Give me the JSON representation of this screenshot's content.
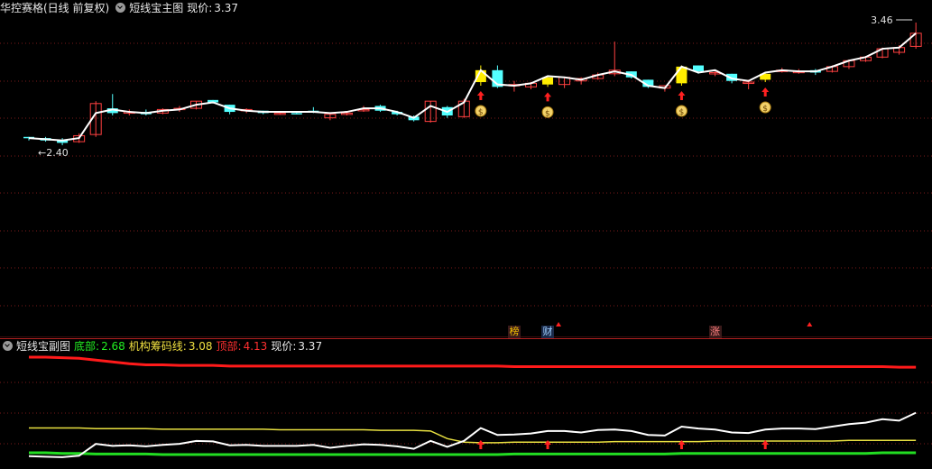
{
  "main_panel": {
    "title": "华控赛格(日线 前复权)",
    "indicator": "短线宝主图",
    "price_label": "现价:",
    "price_value": "3.37",
    "high_label": "3.46",
    "low_label": "2.40"
  },
  "sub_panel": {
    "indicator": "短线宝副图",
    "bottom_label": "底部:",
    "bottom_value": "2.68",
    "chip_label": "机构筹码线:",
    "chip_value": "3.08",
    "top_label": "顶部:",
    "top_value": "4.13",
    "price_label": "现价:",
    "price_value": "3.37"
  },
  "tags": [
    {
      "text": "榜",
      "color": "#f0c000",
      "bg": "#3a1a1a",
      "index": 29
    },
    {
      "text": "财",
      "color": "#9fd0ff",
      "bg": "#1a2a4a",
      "index": 31
    },
    {
      "text": "涨",
      "color": "#ff8080",
      "bg": "#3a1a1a",
      "index": 41
    }
  ],
  "colors": {
    "up": "#ff4040",
    "down": "#54ffff",
    "signal": "#ffee00",
    "grid": "#7a1a1a",
    "top": "#ff1a1a",
    "chip": "#e8e040",
    "bottom": "#22dd22",
    "white": "#ffffff"
  },
  "chart_data": [
    {
      "type": "candlestick",
      "title": "短线宝主图",
      "ylim": [
        2.3,
        3.55
      ],
      "annotations": {
        "max": 3.46,
        "min": 2.4
      },
      "candles": [
        {
          "o": 2.5,
          "h": 2.5,
          "l": 2.47,
          "c": 2.49,
          "d": "down"
        },
        {
          "o": 2.49,
          "h": 2.5,
          "l": 2.46,
          "c": 2.47,
          "d": "down"
        },
        {
          "o": 2.47,
          "h": 2.49,
          "l": 2.43,
          "c": 2.45,
          "d": "down"
        },
        {
          "o": 2.46,
          "h": 2.53,
          "l": 2.45,
          "c": 2.51,
          "d": "up"
        },
        {
          "o": 2.52,
          "h": 2.8,
          "l": 2.5,
          "c": 2.78,
          "d": "up"
        },
        {
          "o": 2.74,
          "h": 2.86,
          "l": 2.68,
          "c": 2.7,
          "d": "down"
        },
        {
          "o": 2.71,
          "h": 2.73,
          "l": 2.68,
          "c": 2.71,
          "d": "up"
        },
        {
          "o": 2.71,
          "h": 2.73,
          "l": 2.68,
          "c": 2.69,
          "d": "down"
        },
        {
          "o": 2.7,
          "h": 2.74,
          "l": 2.69,
          "c": 2.73,
          "d": "up"
        },
        {
          "o": 2.73,
          "h": 2.76,
          "l": 2.71,
          "c": 2.74,
          "d": "up"
        },
        {
          "o": 2.74,
          "h": 2.8,
          "l": 2.73,
          "c": 2.8,
          "d": "up"
        },
        {
          "o": 2.81,
          "h": 2.81,
          "l": 2.78,
          "c": 2.79,
          "d": "down"
        },
        {
          "o": 2.77,
          "h": 2.77,
          "l": 2.69,
          "c": 2.71,
          "d": "down"
        },
        {
          "o": 2.72,
          "h": 2.74,
          "l": 2.7,
          "c": 2.73,
          "d": "up"
        },
        {
          "o": 2.72,
          "h": 2.72,
          "l": 2.69,
          "c": 2.7,
          "d": "down"
        },
        {
          "o": 2.7,
          "h": 2.71,
          "l": 2.69,
          "c": 2.7,
          "d": "up"
        },
        {
          "o": 2.7,
          "h": 2.71,
          "l": 2.69,
          "c": 2.7,
          "d": "down"
        },
        {
          "o": 2.71,
          "h": 2.75,
          "l": 2.7,
          "c": 2.72,
          "d": "down"
        },
        {
          "o": 2.69,
          "h": 2.7,
          "l": 2.64,
          "c": 2.66,
          "d": "up"
        },
        {
          "o": 2.69,
          "h": 2.71,
          "l": 2.68,
          "c": 2.7,
          "d": "up"
        },
        {
          "o": 2.72,
          "h": 2.76,
          "l": 2.71,
          "c": 2.73,
          "d": "up"
        },
        {
          "o": 2.76,
          "h": 2.77,
          "l": 2.71,
          "c": 2.72,
          "d": "down"
        },
        {
          "o": 2.71,
          "h": 2.72,
          "l": 2.68,
          "c": 2.69,
          "d": "down"
        },
        {
          "o": 2.67,
          "h": 2.68,
          "l": 2.63,
          "c": 2.64,
          "d": "down"
        },
        {
          "o": 2.63,
          "h": 2.8,
          "l": 2.62,
          "c": 2.8,
          "d": "up"
        },
        {
          "o": 2.75,
          "h": 2.76,
          "l": 2.66,
          "c": 2.68,
          "d": "down"
        },
        {
          "o": 2.67,
          "h": 2.82,
          "l": 2.66,
          "c": 2.8,
          "d": "up"
        },
        {
          "o": 2.96,
          "h": 3.1,
          "l": 2.93,
          "c": 3.06,
          "d": "signal"
        },
        {
          "o": 3.06,
          "h": 3.1,
          "l": 2.91,
          "c": 2.92,
          "d": "down"
        },
        {
          "o": 2.94,
          "h": 2.97,
          "l": 2.88,
          "c": 2.93,
          "d": "up"
        },
        {
          "o": 2.92,
          "h": 2.96,
          "l": 2.9,
          "c": 2.95,
          "d": "up"
        },
        {
          "o": 2.94,
          "h": 3.01,
          "l": 2.92,
          "c": 3.0,
          "d": "signal"
        },
        {
          "o": 2.94,
          "h": 3.0,
          "l": 2.91,
          "c": 3.0,
          "d": "up"
        },
        {
          "o": 2.99,
          "h": 3.0,
          "l": 2.94,
          "c": 2.97,
          "d": "up"
        },
        {
          "o": 2.99,
          "h": 3.04,
          "l": 2.98,
          "c": 3.02,
          "d": "up"
        },
        {
          "o": 3.06,
          "h": 3.3,
          "l": 3.01,
          "c": 3.03,
          "d": "up"
        },
        {
          "o": 3.05,
          "h": 3.05,
          "l": 2.99,
          "c": 3.0,
          "d": "down"
        },
        {
          "o": 2.98,
          "h": 2.98,
          "l": 2.91,
          "c": 2.92,
          "d": "down"
        },
        {
          "o": 2.93,
          "h": 2.93,
          "l": 2.88,
          "c": 2.91,
          "d": "up"
        },
        {
          "o": 2.95,
          "h": 3.1,
          "l": 2.93,
          "c": 3.09,
          "d": "signal"
        },
        {
          "o": 3.1,
          "h": 3.1,
          "l": 3.03,
          "c": 3.05,
          "d": "down"
        },
        {
          "o": 3.04,
          "h": 3.05,
          "l": 3.01,
          "c": 3.03,
          "d": "up"
        },
        {
          "o": 3.03,
          "h": 3.03,
          "l": 2.95,
          "c": 2.97,
          "d": "down"
        },
        {
          "o": 2.96,
          "h": 2.98,
          "l": 2.9,
          "c": 2.96,
          "d": "up"
        },
        {
          "o": 2.98,
          "h": 3.04,
          "l": 2.96,
          "c": 3.03,
          "d": "signal"
        },
        {
          "o": 3.06,
          "h": 3.08,
          "l": 3.04,
          "c": 3.05,
          "d": "up"
        },
        {
          "o": 3.05,
          "h": 3.07,
          "l": 3.03,
          "c": 3.05,
          "d": "up"
        },
        {
          "o": 3.06,
          "h": 3.07,
          "l": 3.02,
          "c": 3.04,
          "d": "down"
        },
        {
          "o": 3.05,
          "h": 3.1,
          "l": 3.04,
          "c": 3.09,
          "d": "up"
        },
        {
          "o": 3.09,
          "h": 3.15,
          "l": 3.07,
          "c": 3.14,
          "d": "up"
        },
        {
          "o": 3.14,
          "h": 3.18,
          "l": 3.13,
          "c": 3.17,
          "d": "up"
        },
        {
          "o": 3.17,
          "h": 3.25,
          "l": 3.16,
          "c": 3.24,
          "d": "up"
        },
        {
          "o": 3.25,
          "h": 3.27,
          "l": 3.19,
          "c": 3.21,
          "d": "up"
        },
        {
          "o": 3.26,
          "h": 3.46,
          "l": 3.24,
          "c": 3.37,
          "d": "up"
        }
      ],
      "line": [
        2.49,
        2.48,
        2.47,
        2.49,
        2.7,
        2.73,
        2.71,
        2.7,
        2.72,
        2.73,
        2.77,
        2.79,
        2.74,
        2.72,
        2.71,
        2.71,
        2.71,
        2.71,
        2.7,
        2.71,
        2.74,
        2.74,
        2.71,
        2.66,
        2.76,
        2.71,
        2.79,
        3.06,
        2.94,
        2.93,
        2.95,
        3.01,
        3.0,
        2.98,
        3.02,
        3.05,
        3.02,
        2.93,
        2.91,
        3.09,
        3.04,
        3.06,
        2.99,
        2.97,
        3.04,
        3.06,
        3.05,
        3.05,
        3.09,
        3.14,
        3.17,
        3.24,
        3.25,
        3.37
      ],
      "buy_signals": [
        27,
        31,
        39,
        44
      ]
    },
    {
      "type": "line",
      "title": "短线宝副图",
      "ylim": [
        2.45,
        4.4
      ],
      "series": [
        {
          "name": "顶部",
          "values": [
            4.3,
            4.3,
            4.29,
            4.28,
            4.25,
            4.22,
            4.19,
            4.17,
            4.17,
            4.16,
            4.16,
            4.16,
            4.15,
            4.15,
            4.15,
            4.15,
            4.15,
            4.15,
            4.15,
            4.15,
            4.15,
            4.15,
            4.15,
            4.15,
            4.15,
            4.15,
            4.15,
            4.15,
            4.15,
            4.14,
            4.14,
            4.14,
            4.14,
            4.14,
            4.14,
            4.14,
            4.14,
            4.14,
            4.14,
            4.14,
            4.14,
            4.14,
            4.14,
            4.14,
            4.14,
            4.14,
            4.14,
            4.14,
            4.14,
            4.14,
            4.14,
            4.14,
            4.13,
            4.13
          ]
        },
        {
          "name": "机构筹码线",
          "values": [
            3.1,
            3.1,
            3.1,
            3.1,
            3.09,
            3.09,
            3.09,
            3.09,
            3.08,
            3.08,
            3.08,
            3.08,
            3.08,
            3.08,
            3.08,
            3.07,
            3.07,
            3.07,
            3.07,
            3.07,
            3.07,
            3.06,
            3.06,
            3.06,
            3.05,
            2.92,
            2.86,
            2.85,
            2.85,
            2.86,
            2.86,
            2.86,
            2.86,
            2.86,
            2.86,
            2.87,
            2.87,
            2.87,
            2.87,
            2.87,
            2.87,
            2.88,
            2.88,
            2.88,
            2.88,
            2.88,
            2.88,
            2.88,
            2.88,
            2.89,
            2.89,
            2.89,
            2.89,
            2.89
          ]
        },
        {
          "name": "底部",
          "values": [
            2.68,
            2.68,
            2.67,
            2.67,
            2.66,
            2.66,
            2.66,
            2.66,
            2.65,
            2.65,
            2.65,
            2.65,
            2.65,
            2.65,
            2.65,
            2.65,
            2.65,
            2.65,
            2.65,
            2.65,
            2.65,
            2.65,
            2.65,
            2.65,
            2.65,
            2.65,
            2.65,
            2.65,
            2.65,
            2.66,
            2.66,
            2.66,
            2.66,
            2.66,
            2.66,
            2.66,
            2.66,
            2.66,
            2.66,
            2.67,
            2.67,
            2.67,
            2.67,
            2.67,
            2.67,
            2.67,
            2.67,
            2.67,
            2.67,
            2.67,
            2.67,
            2.68,
            2.68,
            2.68
          ]
        },
        {
          "name": "现价",
          "values": [
            2.49,
            2.48,
            2.47,
            2.5,
            2.74,
            2.7,
            2.71,
            2.69,
            2.72,
            2.74,
            2.8,
            2.79,
            2.71,
            2.72,
            2.7,
            2.7,
            2.7,
            2.72,
            2.66,
            2.7,
            2.73,
            2.72,
            2.69,
            2.64,
            2.8,
            2.68,
            2.8,
            3.06,
            2.92,
            2.93,
            2.95,
            3.0,
            3.0,
            2.97,
            3.02,
            3.03,
            3.0,
            2.92,
            2.91,
            3.09,
            3.05,
            3.03,
            2.97,
            2.96,
            3.03,
            3.05,
            3.05,
            3.04,
            3.09,
            3.14,
            3.17,
            3.24,
            3.21,
            3.37
          ]
        }
      ],
      "buy_signals": [
        27,
        31,
        39,
        44
      ]
    }
  ]
}
